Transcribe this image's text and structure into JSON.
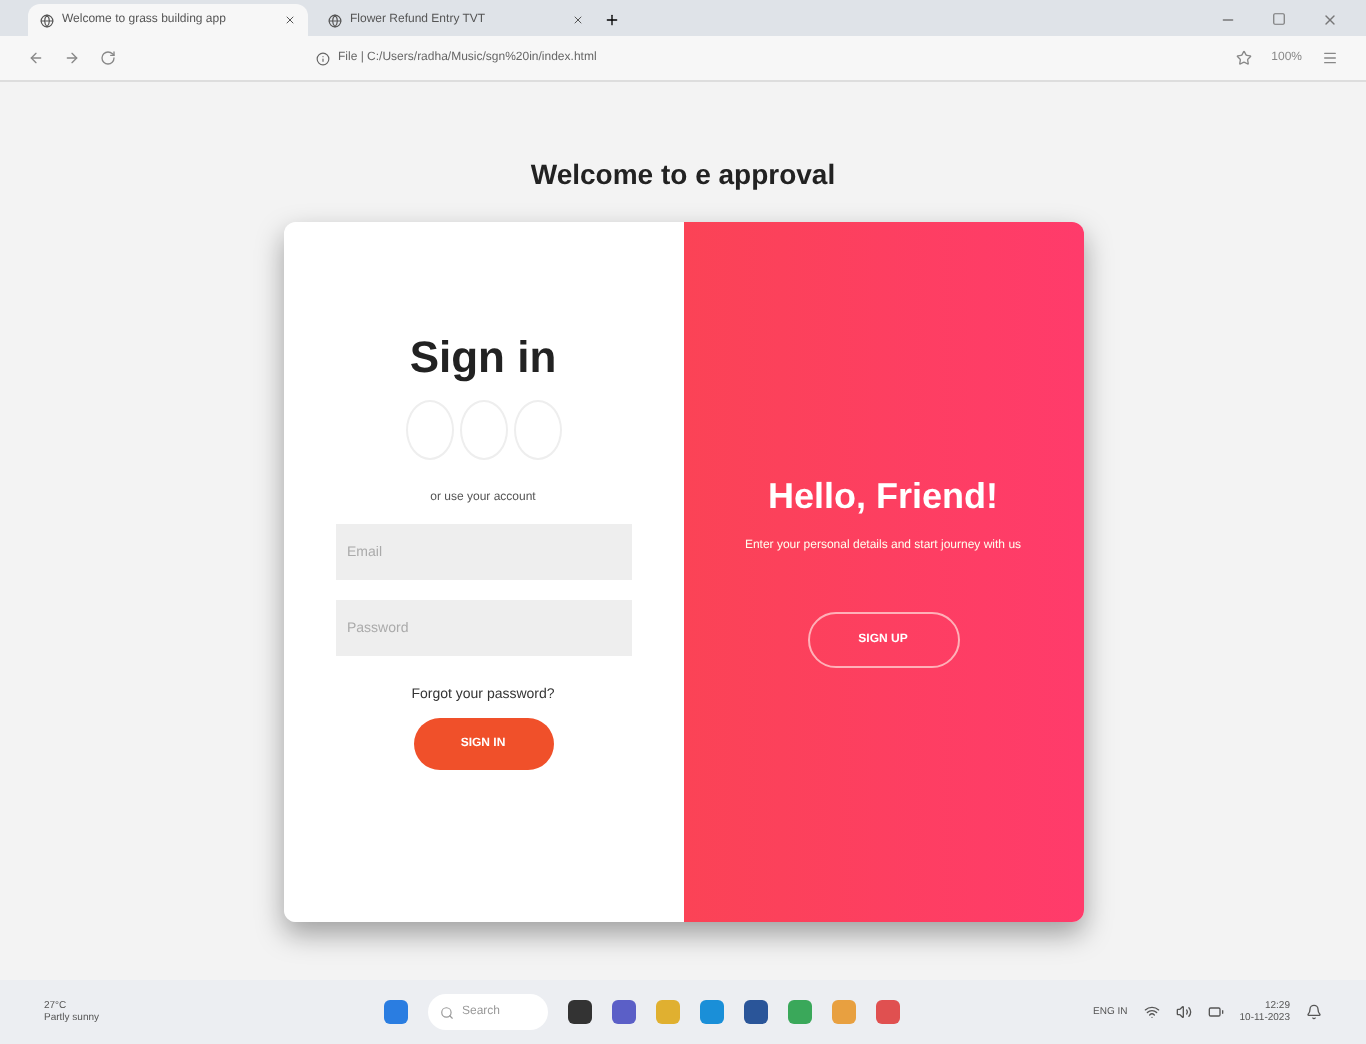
{
  "browser": {
    "tabs": [
      {
        "title": "Welcome to grass building app",
        "selected": true
      },
      {
        "title": "Flower Refund Entry TVT",
        "selected": false
      }
    ],
    "url": "File | C:/Users/radha/Music/sgn%20in/index.html",
    "zoom": "100%"
  },
  "page": {
    "heading": "Welcome to e approval",
    "sign_in": {
      "title": "Sign in",
      "hint": "or use your account",
      "email": {
        "placeholder": "Email"
      },
      "password": {
        "placeholder": "Password"
      },
      "forgot": "Forgot your password?",
      "button": "SIGN IN"
    },
    "overlay": {
      "title": "Hello, Friend!",
      "text": "Enter your personal details and start journey with us",
      "button": "SIGN UP"
    }
  },
  "taskbar": {
    "weather": {
      "temp": "27°C",
      "condition": "Partly sunny"
    },
    "search": {
      "placeholder": "Search"
    },
    "language": "ENG IN",
    "time": "12:29",
    "date": "10-11-2023"
  }
}
